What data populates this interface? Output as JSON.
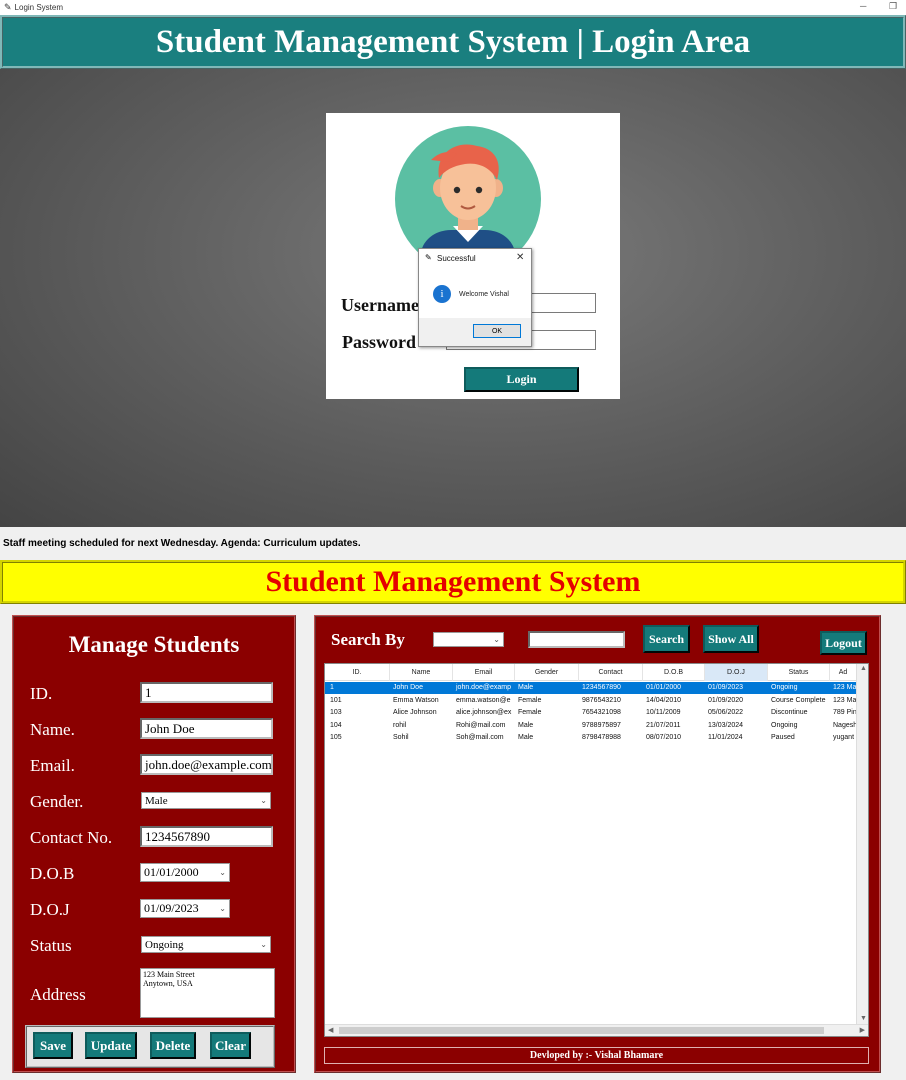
{
  "window": {
    "title": "Login System",
    "app_icon": "feather-icon"
  },
  "login": {
    "banner": "Student Management System | Login Area",
    "username_label": "Username",
    "password_label": "Password",
    "username_value": "",
    "password_value": "",
    "button": "Login"
  },
  "dialog": {
    "title": "Successful",
    "message": "Welcome Vishal",
    "ok": "OK",
    "close": "✕"
  },
  "notice": "Staff meeting scheduled for next Wednesday. Agenda: Curriculum updates.",
  "app": {
    "banner": "Student Management System"
  },
  "manage": {
    "title": "Manage Students",
    "fields": {
      "id": {
        "label": "ID.",
        "value": "1"
      },
      "name": {
        "label": "Name.",
        "value": "John Doe"
      },
      "email": {
        "label": "Email.",
        "value": "john.doe@example.com"
      },
      "gender": {
        "label": "Gender.",
        "value": "Male"
      },
      "contact": {
        "label": "Contact No.",
        "value": "1234567890"
      },
      "dob": {
        "label": "D.O.B",
        "value": "01/01/2000"
      },
      "doj": {
        "label": "D.O.J",
        "value": "01/09/2023"
      },
      "status": {
        "label": "Status",
        "value": "Ongoing"
      },
      "address": {
        "label": "Address",
        "line1": "123 Main Street",
        "line2": "Anytown, USA"
      }
    },
    "buttons": {
      "save": "Save",
      "update": "Update",
      "delete": "Delete",
      "clear": "Clear"
    }
  },
  "search": {
    "label": "Search By",
    "by_value": "",
    "text_value": "",
    "search_btn": "Search",
    "show_all_btn": "Show All",
    "logout_btn": "Logout"
  },
  "table": {
    "columns": [
      "ID.",
      "Name",
      "Email",
      "Gender",
      "Contact",
      "D.O.B",
      "D.O.J",
      "Status",
      "Ad"
    ],
    "rows": [
      [
        "1",
        "John Doe",
        "john.doe@examp",
        "Male",
        "1234567890",
        "01/01/2000",
        "01/09/2023",
        "Ongoing",
        "123 Ma"
      ],
      [
        "101",
        "Emma Watson",
        "emma.watson@e",
        "Female",
        "9876543210",
        "14/04/2010",
        "01/09/2020",
        "Course Complete",
        "123 Ma"
      ],
      [
        "103",
        "Alice Johnson",
        "alice.johnson@ex",
        "Female",
        "7654321098",
        "10/11/2009",
        "05/06/2022",
        "Discontinue",
        "789 Pin"
      ],
      [
        "104",
        "rohil",
        "Rohi@mail.com",
        "Male",
        "9788975897",
        "21/07/2011",
        "13/03/2024",
        "Ongoing",
        "Nagesh"
      ],
      [
        "105",
        "Sohil",
        "Soh@mail.com",
        "Male",
        "8798478988",
        "08/07/2010",
        "11/01/2024",
        "Paused",
        "yugant"
      ]
    ]
  },
  "footer": "Devloped by :- Vishal Bhamare",
  "colors": {
    "teal": "#147a7a",
    "maroon": "#8b0000",
    "yellow": "#ffff00",
    "red_text": "#e40000",
    "selection": "#0078d7"
  }
}
